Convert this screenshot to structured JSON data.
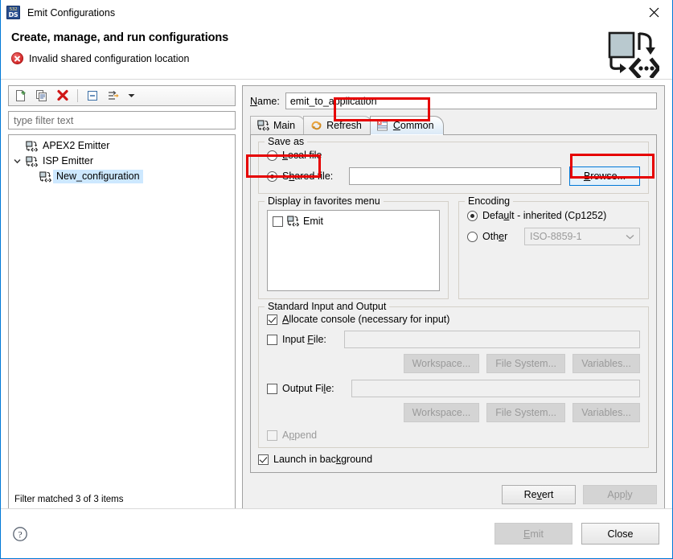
{
  "window": {
    "title": "Emit Configurations",
    "title_icon": "emit-configurations-icon",
    "icon_text_top": "532",
    "icon_text_bottom": "DS",
    "close_icon": "close-icon"
  },
  "header": {
    "title": "Create, manage, and run configurations",
    "message": "Invalid shared configuration location",
    "message_icon": "error-icon",
    "banner_icon": "launch-configurations-banner-icon"
  },
  "tree_toolbar": {
    "new_label": "new-configuration-icon",
    "duplicate_label": "duplicate-configuration-icon",
    "delete_label": "delete-configuration-icon",
    "collapse_label": "collapse-all-icon",
    "filter_label": "filter-launch-configurations-icon",
    "menu_label": "view-menu-caret-icon"
  },
  "filter": {
    "placeholder": "type filter text",
    "value": "type filter text"
  },
  "tree": {
    "items": [
      {
        "label": "APEX2 Emitter",
        "level": 0,
        "expandable": false,
        "expanded": false,
        "selected": false
      },
      {
        "label": "ISP Emitter",
        "level": 0,
        "expandable": true,
        "expanded": true,
        "selected": false
      },
      {
        "label": "New_configuration",
        "level": 1,
        "expandable": false,
        "expanded": false,
        "selected": true
      }
    ],
    "status": "Filter matched 3 of 3 items"
  },
  "name": {
    "label": "Name:",
    "label_mnemonic": "N",
    "value": "emit_to_application"
  },
  "tabs": [
    {
      "label": "Main",
      "icon": "emit-configuration-icon",
      "active": false
    },
    {
      "label": "Refresh",
      "icon": "refresh-icon",
      "active": false
    },
    {
      "label": "Common",
      "icon": "common-tab-icon",
      "active": true,
      "mnemonic": "C"
    }
  ],
  "save_as": {
    "group_label": "Save as",
    "local_file": {
      "label": "Local file",
      "selected": false
    },
    "shared_file": {
      "label": "Shared file:",
      "selected": true
    },
    "path_value": "",
    "browse_label": "Browse...",
    "browse_mnemonic": "B"
  },
  "favorites": {
    "group_label": "Display in favorites menu",
    "items": [
      {
        "label": "Emit",
        "checked": false,
        "icon": "emit-configuration-icon"
      }
    ]
  },
  "encoding": {
    "group_label": "Encoding",
    "default_option": {
      "label": "Default - inherited (Cp1252)",
      "selected": true
    },
    "other_option": {
      "label": "Other",
      "selected": false
    },
    "other_value": "ISO-8859-1",
    "other_enabled": false
  },
  "stdio": {
    "group_label": "Standard Input and Output",
    "allocate_console": {
      "label": "Allocate console (necessary for input)",
      "checked": true
    },
    "input_file": {
      "label": "Input File:",
      "checked": false,
      "value": ""
    },
    "input_buttons": [
      {
        "label": "Workspace...",
        "enabled": false
      },
      {
        "label": "File System...",
        "enabled": false
      },
      {
        "label": "Variables...",
        "enabled": false
      }
    ],
    "output_file": {
      "label": "Output File:",
      "checked": false,
      "value": ""
    },
    "output_buttons": [
      {
        "label": "Workspace...",
        "enabled": false
      },
      {
        "label": "File System...",
        "enabled": false
      },
      {
        "label": "Variables...",
        "enabled": false
      }
    ],
    "append": {
      "label": "Append",
      "checked": false,
      "enabled": false
    }
  },
  "launch_in_background": {
    "label": "Launch in background",
    "checked": true
  },
  "apply_bar": {
    "revert": {
      "label": "Revert",
      "enabled": true
    },
    "apply": {
      "label": "Apply",
      "enabled": false
    }
  },
  "footer": {
    "help_icon": "help-icon",
    "emit": {
      "label": "Emit",
      "enabled": false
    },
    "close": {
      "label": "Close",
      "enabled": true
    }
  },
  "annotations": {
    "highlight_color": "#e60000",
    "boxes": [
      "common-tab",
      "shared-file-radio",
      "browse-button"
    ]
  }
}
